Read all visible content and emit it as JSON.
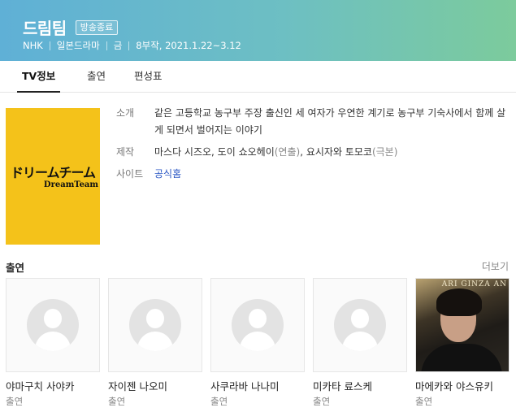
{
  "header": {
    "title": "드림팀",
    "badge": "방송종료",
    "meta": [
      "NHK",
      "일본드라마",
      "금",
      "8부작, 2021.1.22~3.12"
    ],
    "colors": {
      "gradient_start": "#5fb0d6",
      "gradient_end": "#7ccb9c"
    }
  },
  "tabs": [
    {
      "label": "TV정보",
      "active": true
    },
    {
      "label": "출연",
      "active": false
    },
    {
      "label": "편성표",
      "active": false
    }
  ],
  "poster": {
    "title_jp": "ドリームチーム",
    "title_en": "DreamTeam",
    "background": "#f4c21a"
  },
  "info": {
    "synopsis_label": "소개",
    "synopsis": "같은 고등학교 농구부 주장 출신인 세 여자가 우연한 계기로 농구부 기숙사에서 함께 살게 되면서 벌어지는 이야기",
    "production_label": "제작",
    "production_director": "마스다 시즈오, 도이 쇼오헤이",
    "production_director_role": "(연출)",
    "production_writer": "요시자와 토모코",
    "production_writer_role": "(극본)",
    "site_label": "사이트",
    "site_link": "공식홈"
  },
  "cast": {
    "heading": "출연",
    "more": "더보기",
    "items": [
      {
        "name": "야마구치 사야카",
        "role": "출연",
        "photo": "placeholder-person-icon"
      },
      {
        "name": "자이젠 나오미",
        "role": "출연",
        "photo": "placeholder-person-icon"
      },
      {
        "name": "사쿠라바 나나미",
        "role": "출연",
        "photo": "placeholder-person-icon"
      },
      {
        "name": "미카타 료스케",
        "role": "출연",
        "photo": "placeholder-person-icon"
      },
      {
        "name": "마에카와 야스유키",
        "role": "출연",
        "photo": "actor-photo",
        "photo_text": "ARI GINZA AN"
      }
    ]
  }
}
